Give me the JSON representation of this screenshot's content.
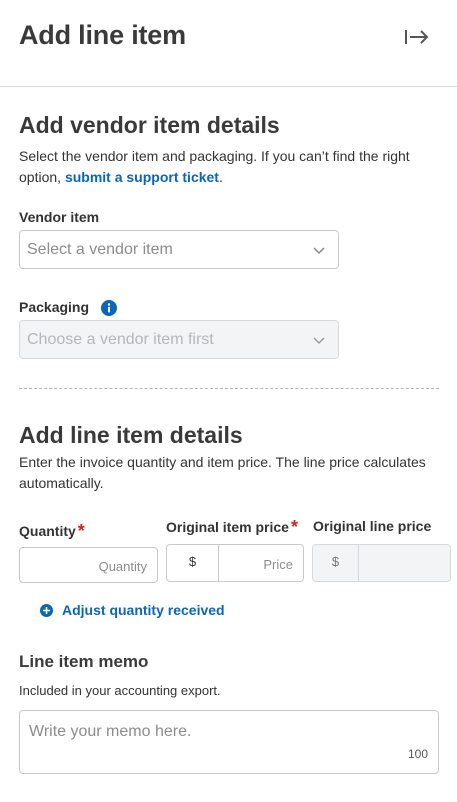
{
  "header": {
    "title": "Add line item",
    "close_icon": "arrow-right-to-bar-icon"
  },
  "vendor_section": {
    "title": "Add vendor item details",
    "description": "Select the vendor item and packaging. If you can’t find the right option,",
    "support_link": "submit a support ticket",
    "description_end": ".",
    "vendor_item": {
      "label": "Vendor item",
      "placeholder": "Select a vendor item"
    },
    "packaging": {
      "label": "Packaging",
      "placeholder": "Choose a vendor item first",
      "info_icon": "info-icon"
    }
  },
  "line_section": {
    "title": "Add line item details",
    "description": "Enter the invoice quantity and item price. The line price calculates automatically.",
    "quantity": {
      "label": "Quantity",
      "required": "*",
      "placeholder": "Quantity"
    },
    "original_item_price": {
      "label": "Original item price",
      "required": "*",
      "prefix": "$",
      "placeholder": "Price"
    },
    "original_line_price": {
      "label": "Original line price",
      "prefix": "$"
    },
    "adjust_link": "Adjust quantity received"
  },
  "memo": {
    "title": "Line item memo",
    "description": "Included in your accounting export.",
    "placeholder": "Write your memo here.",
    "max_chars": "100"
  },
  "colors": {
    "link": "#0a66b8",
    "required": "#d0241b",
    "disabled_bg": "#f2f4f5"
  }
}
